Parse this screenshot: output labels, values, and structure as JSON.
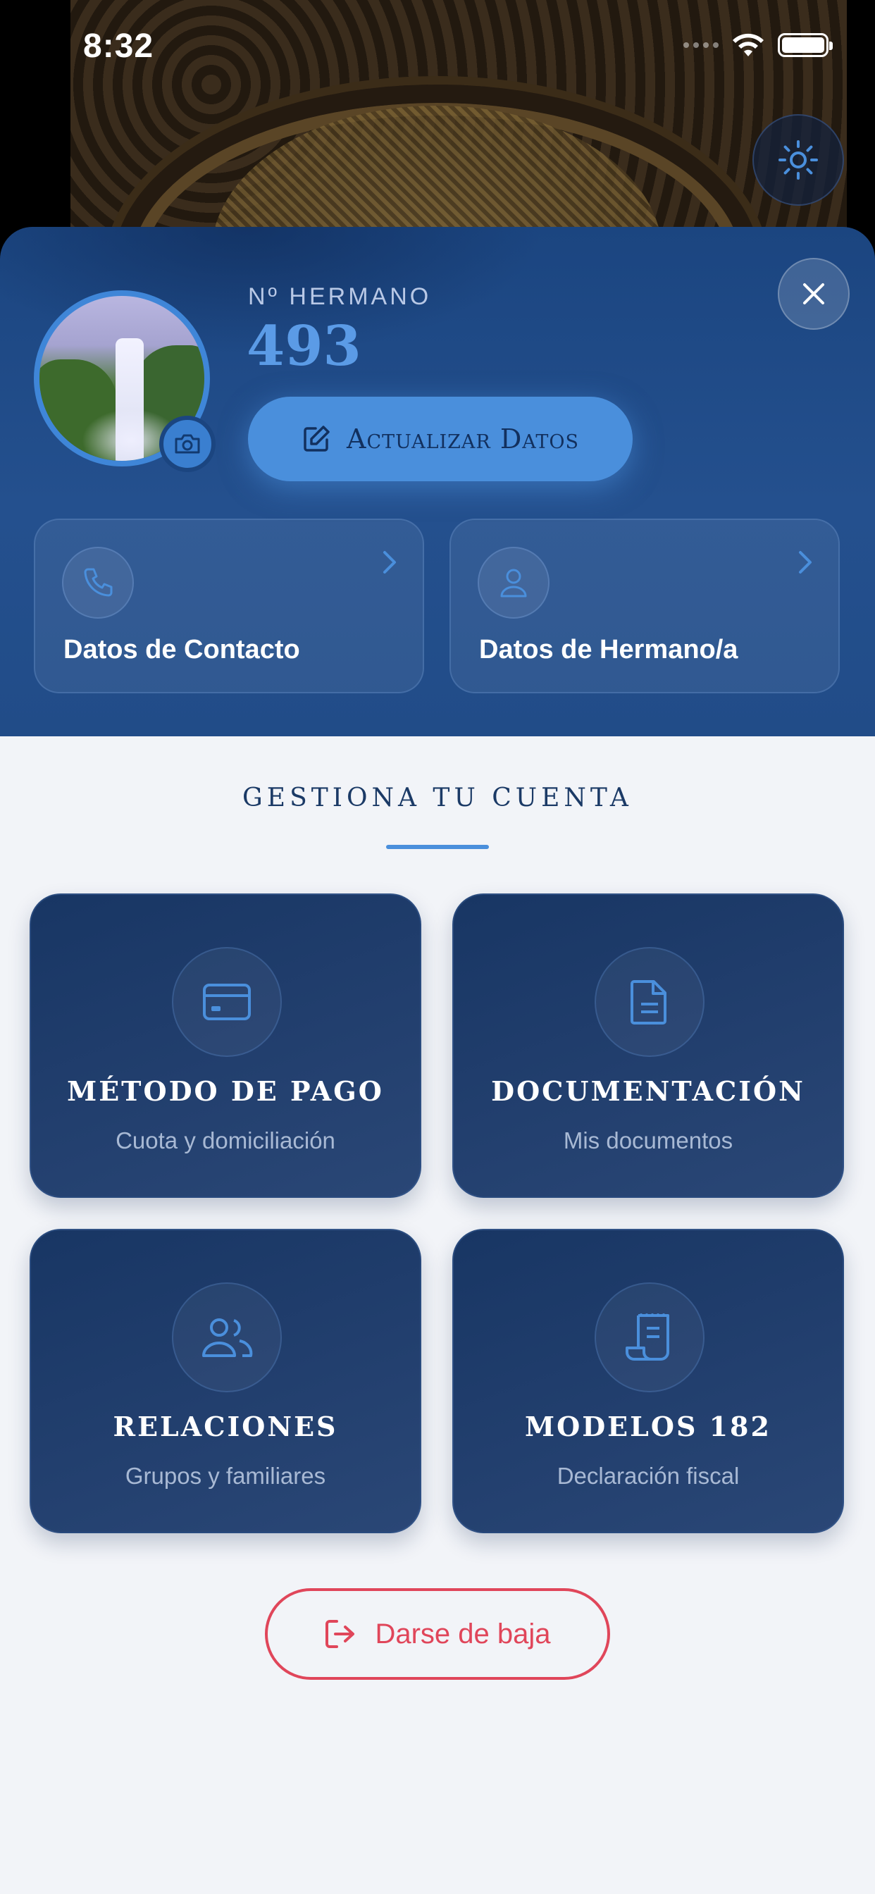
{
  "status_bar": {
    "time": "8:32"
  },
  "profile": {
    "member_label": "Nº HERMANO",
    "member_number": "493",
    "update_button_label": "Actualizar Datos",
    "tiles": [
      {
        "label": "Datos de Contacto",
        "icon": "phone-icon"
      },
      {
        "label": "Datos de Hermano/a",
        "icon": "user-icon"
      }
    ]
  },
  "account": {
    "title": "GESTIONA TU CUENTA",
    "tiles": [
      {
        "title": "MÉTODO DE PAGO",
        "subtitle": "Cuota y domiciliación",
        "icon": "credit-card-icon"
      },
      {
        "title": "DOCUMENTACIÓN",
        "subtitle": "Mis documentos",
        "icon": "document-icon"
      },
      {
        "title": "RELACIONES",
        "subtitle": "Grupos y familiares",
        "icon": "users-icon"
      },
      {
        "title": "MODELOS 182",
        "subtitle": "Declaración fiscal",
        "icon": "receipt-scroll-icon"
      }
    ],
    "logout_label": "Darse de baja"
  },
  "colors": {
    "accent": "#4a8fdc",
    "profile_bg": "#1b4580",
    "tile_bg": "#183664",
    "danger": "#e0465a",
    "page_bg": "#f2f4f8"
  }
}
